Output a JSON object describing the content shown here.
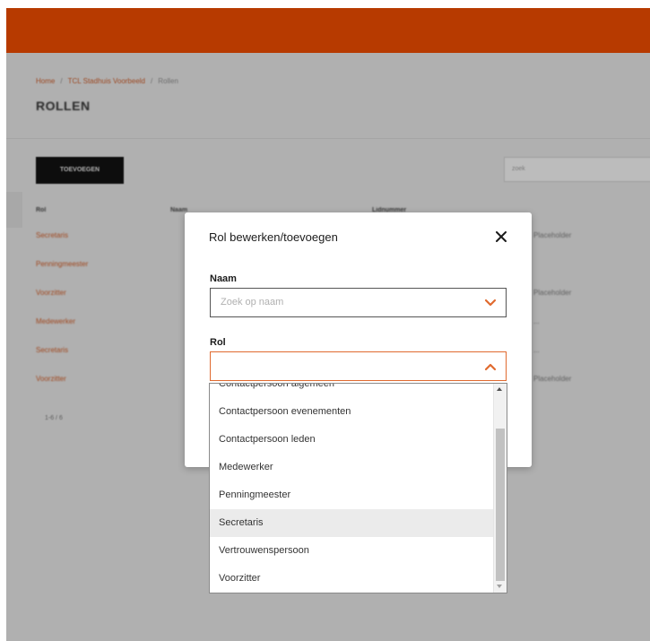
{
  "background": {
    "breadcrumb": [
      "Home",
      "TCL Stadhuis Voorbeeld",
      "Rollen"
    ],
    "page_title": "ROLLEN",
    "add_button_label": "TOEVOEGEN",
    "search_placeholder": "zoek",
    "table_headers": [
      "Rol",
      "Naam",
      "Lidnummer"
    ],
    "table_rows": [
      {
        "rol": "Secretaris",
        "info": "Placeholder"
      },
      {
        "rol": "Penningmeester",
        "info": ""
      },
      {
        "rol": "Voorzitter",
        "info": "Placeholder"
      },
      {
        "rol": "Medewerker",
        "info": "..."
      },
      {
        "rol": "Secretaris",
        "info": "..."
      },
      {
        "rol": "Voorzitter",
        "info": "Placeholder"
      }
    ],
    "pager": "1-6 / 6"
  },
  "modal": {
    "title": "Rol bewerken/toevoegen",
    "naam_label": "Naam",
    "naam_placeholder": "Zoek op naam",
    "rol_label": "Rol",
    "rol_value": ""
  },
  "dropdown": {
    "options": [
      "Contactpersoon algemeen",
      "Contactpersoon evenementen",
      "Contactpersoon leden",
      "Medewerker",
      "Penningmeester",
      "Secretaris",
      "Vertrouwenspersoon",
      "Voorzitter"
    ],
    "highlighted_option": "Secretaris"
  },
  "colors": {
    "brand": "#b73a00",
    "accent": "#e06a2f",
    "link": "#c95a27"
  }
}
